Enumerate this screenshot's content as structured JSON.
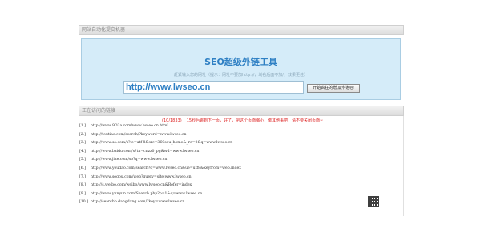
{
  "header": {
    "title": "网站自动化提交机器"
  },
  "seo_box": {
    "title": "SEO超级外链工具",
    "hint": "赶紧输入您的网址（提示：网址不要加http://，域名后面不加/，效果更佳）",
    "url_value": "http://www.lwseo.cn",
    "submit_label": "开始疯狂的增加外链吧!"
  },
  "links_section": {
    "title": "正在访问的链接",
    "progress_count": "(10/1833)",
    "progress_message": "15秒后跳到下一页，好了，把这个页面缩小，做其他事吧！请不要关闭页面~"
  },
  "links": [
    {
      "index": "[1.]",
      "url": "http://www.9D2a.com/www.lwseo.cn.html"
    },
    {
      "index": "[2.]",
      "url": "http://toutiao.com/search/?keyword=www.lwseo.cn"
    },
    {
      "index": "[3.]",
      "url": "http://www.so.com/s?ie=utf-8&src=360sou_home&_re=0&q=www.lwseo.cn"
    },
    {
      "index": "[4.]",
      "url": "http://www.baidu.com/s?tn=cnzz0_pg&wd=www.lwseo.cn"
    },
    {
      "index": "[5.]",
      "url": "http://www.jike.com/so?q=www.lwseo.cn"
    },
    {
      "index": "[6.]",
      "url": "http://www.youdao.com/search?q=www.lwseo.cn&ue=utf8&keyfrom=web.index"
    },
    {
      "index": "[7.]",
      "url": "http://www.sogou.com/web?query=site:www.lwseo.cn"
    },
    {
      "index": "[8.]",
      "url": "http://s.weibo.com/weibo/www.lwseo.cn&Refer=index"
    },
    {
      "index": "[9.]",
      "url": "http://www.yunyun.com/Search.php?p=1&q=www.lwseo.cn"
    },
    {
      "index": "[10.]",
      "url": "http://searchb.dangdang.com/?key=www.lwseo.cn"
    }
  ],
  "colors": {
    "accent": "#2f80c4",
    "box_bg": "#d5ecf9",
    "warning": "#dd2222"
  },
  "icons": {
    "qr": "qr-code-icon"
  }
}
